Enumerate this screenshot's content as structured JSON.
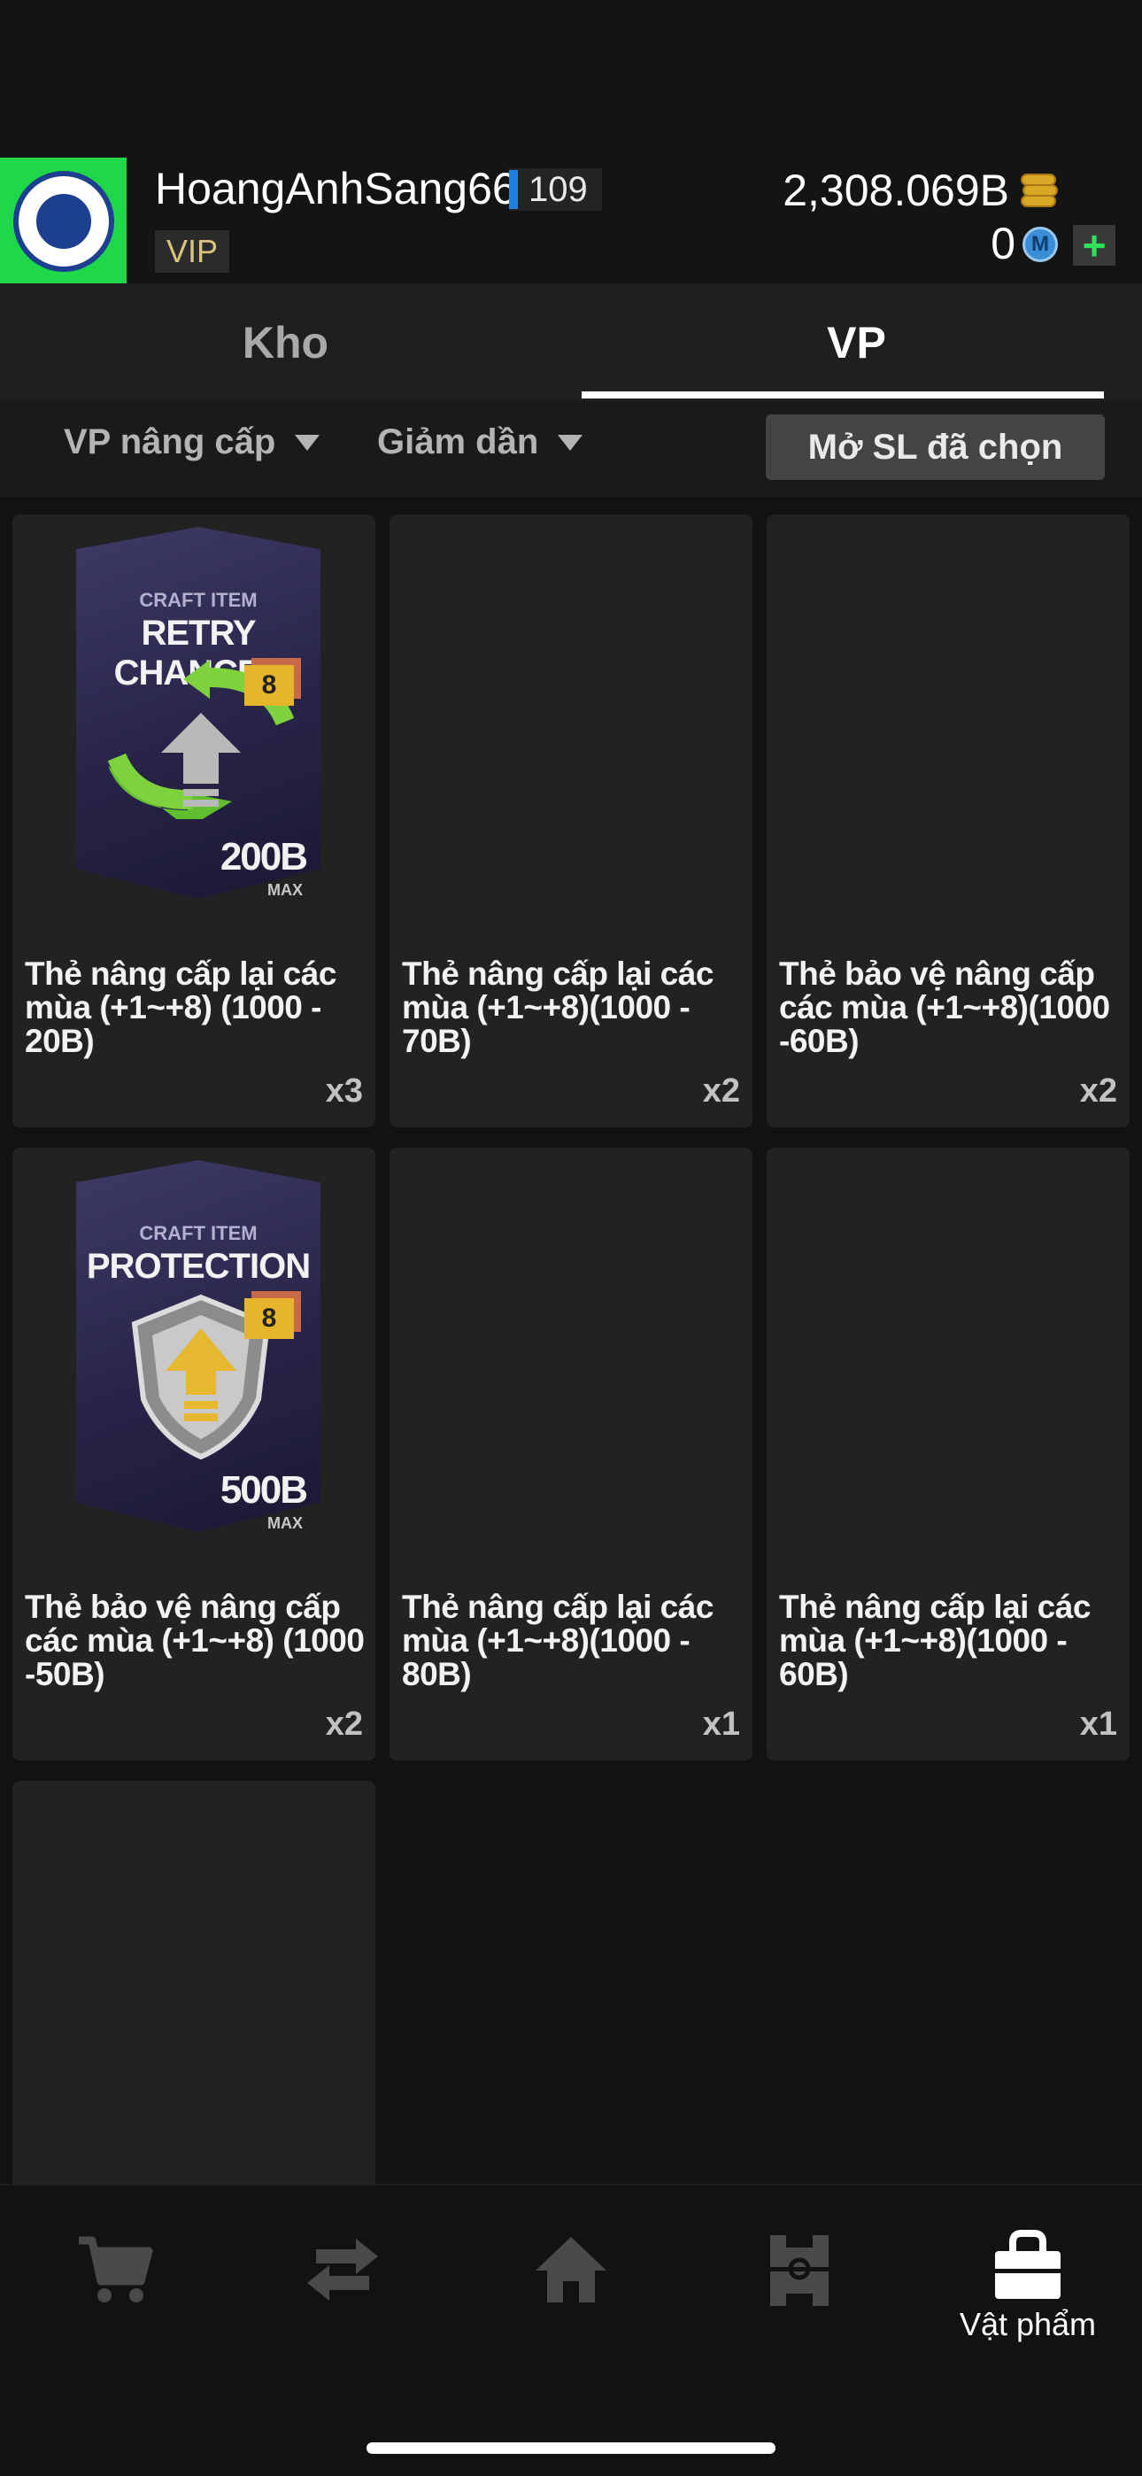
{
  "header": {
    "username": "HoangAnhSang66",
    "level": "109",
    "vip_label": "VIP",
    "coins": "2,308.069B",
    "m_count": "0",
    "m_icon_letter": "M",
    "plus_label": "+"
  },
  "tabs": [
    {
      "label": "Kho",
      "active": false
    },
    {
      "label": "VP",
      "active": true
    }
  ],
  "filters": {
    "sort_type": "VP nâng cấp",
    "sort_order": "Giảm dần",
    "open_selected": "Mở SL đã chọn"
  },
  "items": [
    {
      "name": "Thẻ nâng cấp lại các mùa (+1~+8) (1000 - 20B)",
      "qty": "x3",
      "art": {
        "craft": "CRAFT ITEM",
        "title": "RETRY CHANCES",
        "price": "200B",
        "max": "MAX",
        "badge": "8"
      }
    },
    {
      "name": "Thẻ nâng cấp lại các mùa (+1~+8)(1000 - 70B)",
      "qty": "x2"
    },
    {
      "name": "Thẻ bảo vệ nâng cấp các mùa (+1~+8)(1000 -60B)",
      "qty": "x2"
    },
    {
      "name": "Thẻ bảo vệ nâng cấp các mùa (+1~+8) (1000 -50B)",
      "qty": "x2",
      "art": {
        "craft": "CRAFT ITEM",
        "title": "PROTECTION",
        "price": "500B",
        "max": "MAX",
        "badge": "8"
      }
    },
    {
      "name": "Thẻ nâng cấp lại các mùa (+1~+8)(1000 - 80B)",
      "qty": "x1"
    },
    {
      "name": "Thẻ nâng cấp lại các mùa (+1~+8)(1000 - 60B)",
      "qty": "x1"
    }
  ],
  "bottom_nav": [
    {
      "icon": "cart-icon",
      "label": ""
    },
    {
      "icon": "transfer-icon",
      "label": ""
    },
    {
      "icon": "home-icon",
      "label": ""
    },
    {
      "icon": "squad-field-icon",
      "label": ""
    },
    {
      "icon": "bag-icon",
      "label": "Vật phẩm",
      "active": true
    }
  ],
  "colors": {
    "background": "#121212",
    "card": "#222222",
    "accent_blue": "#1e7fe0",
    "logo_green": "#1fd84a",
    "plus_green": "#2ee05a",
    "coin_gold": "#d9a826"
  }
}
